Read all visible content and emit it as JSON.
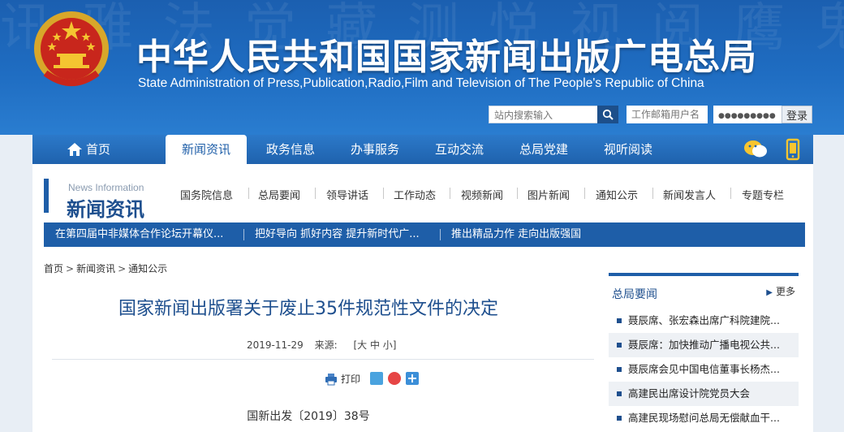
{
  "header": {
    "bg_chars": "讯 雅 法 觉 藏 测 悦 视 阅 鹰 鬼 察 展 戴 宝 福 闻 资 喜 视 联 广 播 电 影",
    "title_cn": "中华人民共和国国家新闻出版广电总局",
    "title_en": "State Administration of Press,Publication,Radio,Film and Television of The People's Republic of China",
    "search_placeholder": "站内搜索输入",
    "user_placeholder": "工作邮箱用户名",
    "password_value": "●●●●●●●●●",
    "login_label": "登录",
    "colors": {
      "brand": "#1e5ea8",
      "bg_top": "#1b5fb0"
    }
  },
  "nav": {
    "home": "首页",
    "items": [
      "新闻资讯",
      "政务信息",
      "办事服务",
      "互动交流",
      "总局党建",
      "视听阅读"
    ],
    "active_index": 0,
    "icons": [
      "wechat-icon",
      "mobile-icon"
    ]
  },
  "section": {
    "en": "News Information",
    "cn": "新闻资讯",
    "subnav": [
      "国务院信息",
      "总局要闻",
      "领导讲话",
      "工作动态",
      "视频新闻",
      "图片新闻",
      "通知公示",
      "新闻发言人",
      "专题专栏"
    ]
  },
  "ticker": [
    "在第四届中非媒体合作论坛开幕仪...",
    "把好导向 抓好内容 提升新时代广...",
    "推出精品力作 走向出版强国"
  ],
  "breadcrumb": [
    "首页",
    "新闻资讯",
    "通知公示"
  ],
  "breadcrumb_sep": ">",
  "article": {
    "title": "国家新闻出版署关于废止35件规范性文件的决定",
    "date": "2019-11-29",
    "source_label": "来源:",
    "font_size_label": "[大 中 小]",
    "print_label": "打印",
    "doc_number": "国新出发〔2019〕38号"
  },
  "sidebar": {
    "title": "总局要闻",
    "more": "更多",
    "items": [
      "聂辰席、张宏森出席广科院建院...",
      "聂辰席：加快推动广播电视公共...",
      "聂辰席会见中国电信董事长杨杰...",
      "高建民出席设计院党员大会",
      "高建民现场慰问总局无偿献血干..."
    ]
  }
}
